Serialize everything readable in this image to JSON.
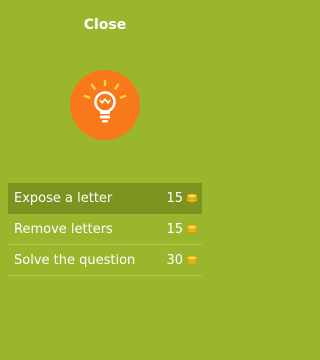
{
  "header": {
    "close_label": "Close"
  },
  "icon": {
    "name": "lightbulb-icon",
    "circle_color": "#f7791b",
    "ray_color": "#ffd23a"
  },
  "options": [
    {
      "label": "Expose a letter",
      "cost": "15",
      "selected": true
    },
    {
      "label": "Remove letters",
      "cost": "15",
      "selected": false
    },
    {
      "label": "Solve the question",
      "cost": "30",
      "selected": false
    }
  ],
  "colors": {
    "background": "#9ab62c",
    "selected_row": "#7c931f",
    "coin": "#f5c518"
  }
}
